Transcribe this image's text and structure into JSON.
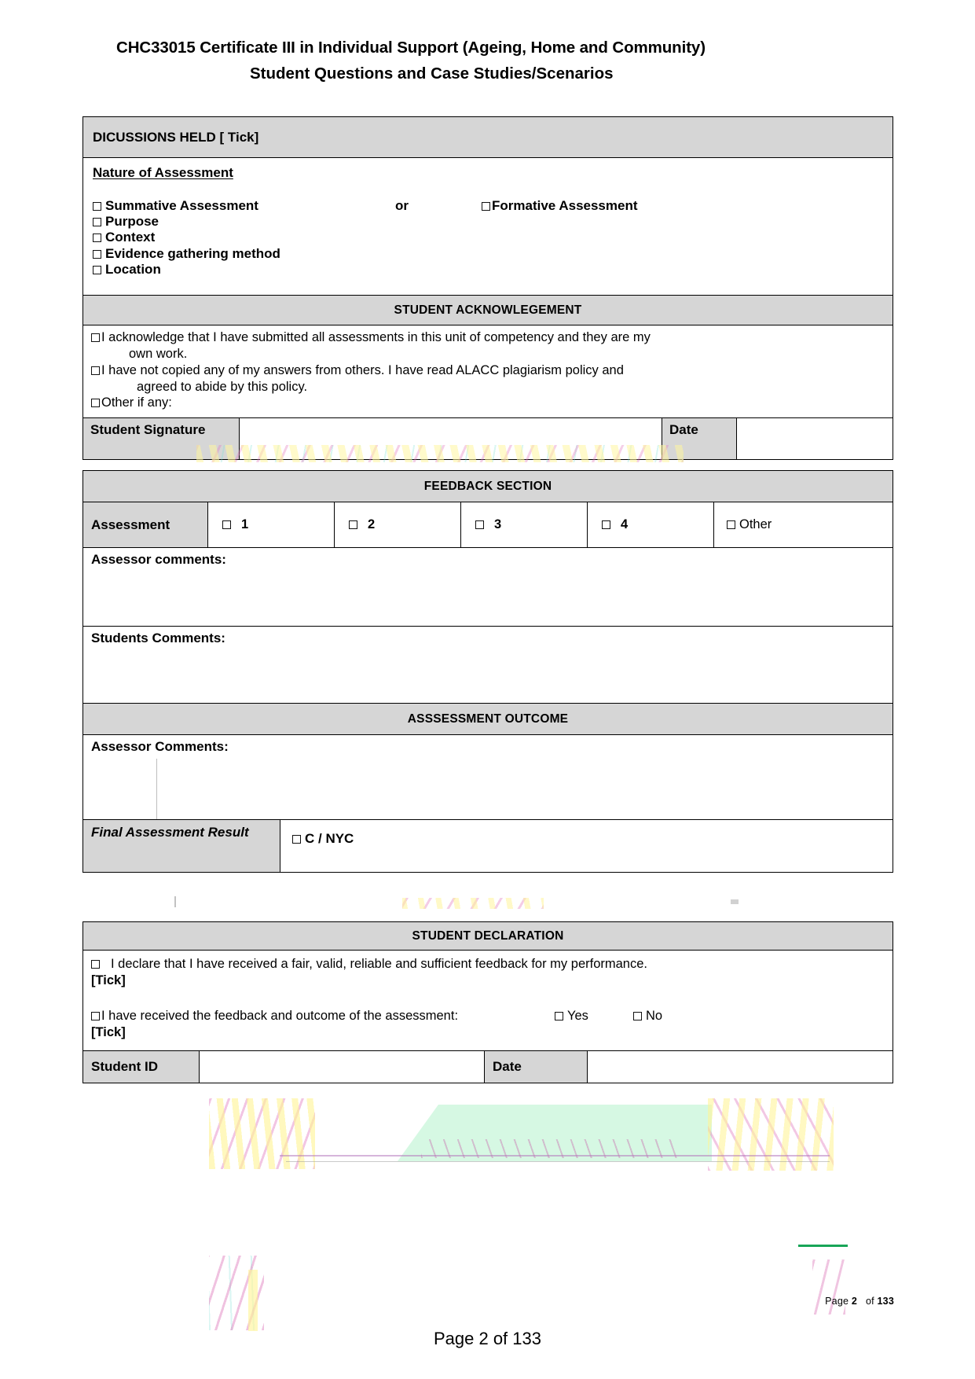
{
  "header": {
    "title_line1": "CHC33015 Certificate III in Individual Support (Ageing, Home and Community)",
    "title_line2": "Student Questions and Case Studies/Scenarios"
  },
  "discussions": {
    "heading": "DICUSSIONS HELD [ Tick]",
    "nature_label": "Nature of Assessment",
    "summative": "Summative Assessment",
    "or": "or",
    "formative": "Formative Assessment",
    "items": [
      "Purpose",
      "Context",
      "Evidence gathering method",
      "Location"
    ]
  },
  "acknowledgement": {
    "heading": "STUDENT ACKNOWLEGEMENT",
    "item1": "I acknowledge that I have submitted all assessments in this unit of competency and they are my",
    "item1_cont": "own work.",
    "item2": "I have not copied any of my answers from others. I have read ALACC plagiarism policy and",
    "item2_cont": "agreed to abide by this policy.",
    "item3": "Other if any:",
    "signature_label": "Student Signature",
    "signature_value": "",
    "date_label": "Date",
    "date_value": ""
  },
  "feedback": {
    "heading": "FEEDBACK SECTION",
    "assessment_label": "Assessment",
    "options": [
      "1",
      "2",
      "3",
      "4"
    ],
    "other_label": "Other",
    "assessor_comments_label": "Assessor comments:",
    "assessor_comments_value": "",
    "students_comments_label": "Students Comments:",
    "students_comments_value": ""
  },
  "outcome": {
    "heading": "ASSSESSMENT OUTCOME",
    "assessor_comments_label": "Assessor Comments:",
    "assessor_comments_value": "",
    "final_label": "Final Assessment Result",
    "final_value": "C / NYC"
  },
  "declaration": {
    "heading": "STUDENT DECLARATION",
    "line1": "I declare that I have received a fair, valid, reliable and sufficient feedback for my performance.",
    "line1_tick": "[Tick]",
    "line2": "I have received the feedback and outcome of the assessment:",
    "yes_label": "Yes",
    "no_label": "No",
    "line2_tick": "[Tick]",
    "student_id_label": "Student ID",
    "student_id_value": "",
    "date_label": "Date",
    "date_value": ""
  },
  "footer": {
    "small_prefix": "Page",
    "small_page": "2",
    "small_of": "of",
    "small_total": "133",
    "main": "Page 2 of 133",
    "accent_color": "#18a558"
  }
}
